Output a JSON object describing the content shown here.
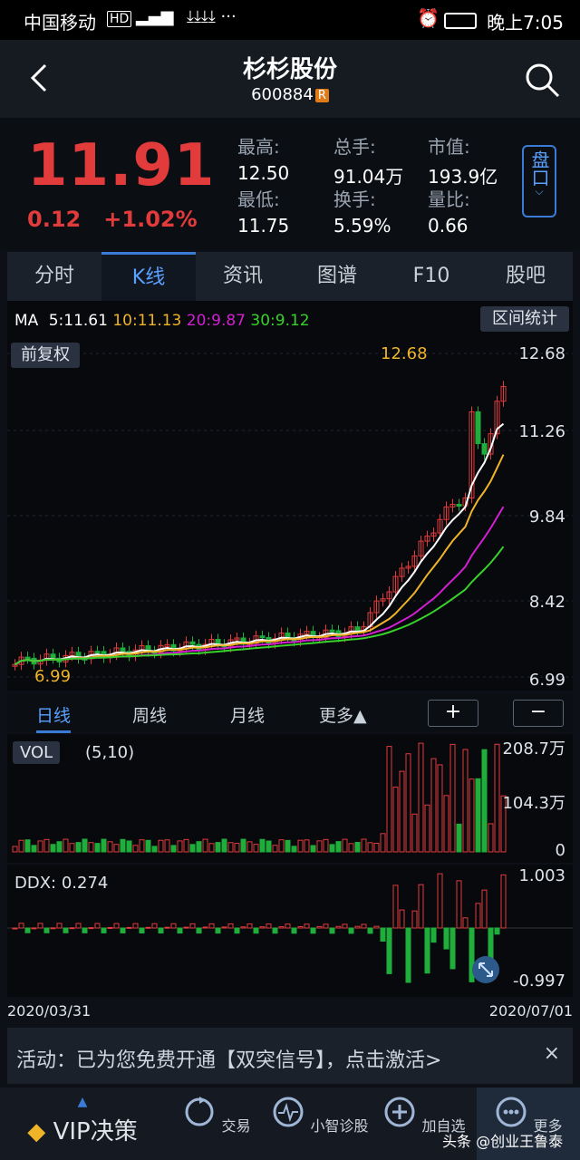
{
  "status_bar": {
    "carrier": "中国移动",
    "time": "晚上7:05"
  },
  "header": {
    "title": "杉杉股份",
    "code": "600884",
    "badge": "R"
  },
  "quote": {
    "price": "11.91",
    "change": "0.12",
    "change_pct": "+1.02%",
    "stats": [
      {
        "label": "最高:",
        "value": "12.50"
      },
      {
        "label": "总手:",
        "value": "91.04万"
      },
      {
        "label": "市值:",
        "value": "193.9亿"
      },
      {
        "label": "最低:",
        "value": "11.75"
      },
      {
        "label": "换手:",
        "value": "5.59%"
      },
      {
        "label": "量比:",
        "value": "0.66"
      }
    ],
    "pankou_label": "盘口"
  },
  "tabs": [
    "分时",
    "K线",
    "资讯",
    "图谱",
    "F10",
    "股吧"
  ],
  "active_tab": "K线",
  "kline": {
    "ma_label": "MA",
    "ma5": "5:11.61",
    "ma10": "10:11.13",
    "ma20": "20:9.87",
    "ma30": "30:9.12",
    "range_stats_button": "区间统计",
    "adjust_button": "前复权",
    "y_labels": [
      "12.68",
      "11.26",
      "9.84",
      "8.42",
      "6.99"
    ],
    "high_marker": "12.68",
    "low_marker": "6.99",
    "colors": {
      "ma5": "#ffffff",
      "ma10": "#f0b429",
      "ma20": "#d21fd2",
      "ma30": "#39d12b",
      "up": "#e23b3b",
      "down": "#1fae3c"
    }
  },
  "period_tabs": [
    "日线",
    "周线",
    "月线",
    "更多▲"
  ],
  "zoom": {
    "in": "+",
    "out": "−"
  },
  "volume": {
    "label": "VOL",
    "params": "(5,10)",
    "y_labels": [
      "208.7万",
      "104.3万",
      "0"
    ]
  },
  "ddx": {
    "label": "DDX: 0.274",
    "y_top": "1.003",
    "y_bottom": "-0.997"
  },
  "dates": {
    "start": "2020/03/31",
    "end": "2020/07/01"
  },
  "banner": {
    "text": "活动：已为您免费开通【双突信号】，点击激活>",
    "close": "×"
  },
  "bottom_nav": [
    {
      "label": "VIP决策",
      "icon": "diamond-icon"
    },
    {
      "label": "交易",
      "icon": "refresh-icon"
    },
    {
      "label": "小智诊股",
      "icon": "pulse-icon"
    },
    {
      "label": "加自选",
      "icon": "plus-circle-icon"
    },
    {
      "label": "更多",
      "icon": "more-icon"
    }
  ],
  "watermark": "头条 @创业王鲁泰"
}
